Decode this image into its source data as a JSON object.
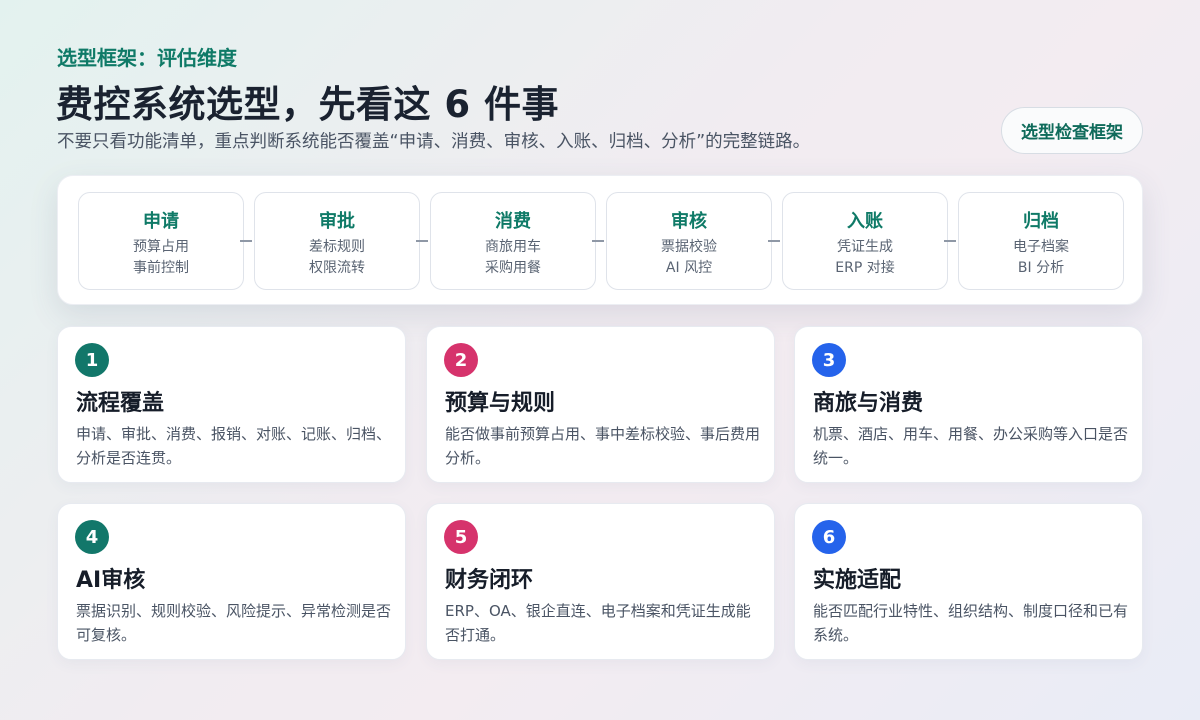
{
  "header": {
    "eyebrow": "选型框架：评估维度",
    "title": "费控系统选型，先看这 6 件事",
    "subtitle": "不要只看功能清单，重点判断系统能否覆盖“申请、消费、审核、入账、归档、分析”的完整链路。",
    "badge": "选型检查框架"
  },
  "flow": [
    {
      "name": "申请",
      "line1": "预算占用",
      "line2": "事前控制"
    },
    {
      "name": "审批",
      "line1": "差标规则",
      "line2": "权限流转"
    },
    {
      "name": "消费",
      "line1": "商旅用车",
      "line2": "采购用餐"
    },
    {
      "name": "审核",
      "line1": "票据校验",
      "line2": "AI 风控"
    },
    {
      "name": "入账",
      "line1": "凭证生成",
      "line2": "ERP 对接"
    },
    {
      "name": "归档",
      "line1": "电子档案",
      "line2": "BI 分析"
    }
  ],
  "cards": [
    {
      "num": "1",
      "title": "流程覆盖",
      "desc": "申请、审批、消费、报销、对账、记账、归档、分析是否连贯。",
      "color": "#12776a"
    },
    {
      "num": "2",
      "title": "预算与规则",
      "desc": "能否做事前预算占用、事中差标校验、事后费用分析。",
      "color": "#d6336c"
    },
    {
      "num": "3",
      "title": "商旅与消费",
      "desc": "机票、酒店、用车、用餐、办公采购等入口是否统一。",
      "color": "#2563eb"
    },
    {
      "num": "4",
      "title": "AI审核",
      "desc": "票据识别、规则校验、风险提示、异常检测是否可复核。",
      "color": "#12776a"
    },
    {
      "num": "5",
      "title": "财务闭环",
      "desc": "ERP、OA、银企直连、电子档案和凭证生成能否打通。",
      "color": "#d6336c"
    },
    {
      "num": "6",
      "title": "实施适配",
      "desc": "能否匹配行业特性、组织结构、制度口径和已有系统。",
      "color": "#2563eb"
    }
  ]
}
